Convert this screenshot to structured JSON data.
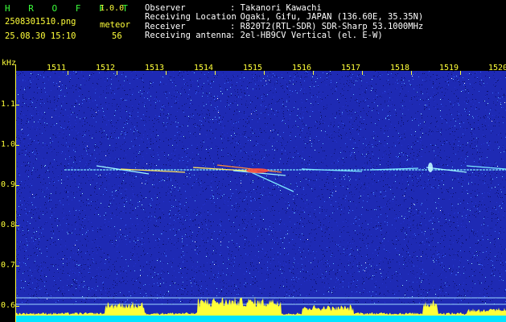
{
  "app": {
    "name": "H R O F F T",
    "version": "1.0.0"
  },
  "file": {
    "name": "2508301510.png",
    "datetime": "25.08.30 15:10"
  },
  "detection": {
    "label": "meteor",
    "count": "56"
  },
  "info": {
    "rows": [
      {
        "label": "Observer",
        "value": ": Takanori Kawachi"
      },
      {
        "label": "Receiving Location",
        "value": ": Ogaki, Gifu, JAPAN (136.60E, 35.35N)"
      },
      {
        "label": "Receiver",
        "value": ": R820T2(RTL-SDR) SDR-Sharp 53.1000MHz"
      },
      {
        "label": "Receiving antenna",
        "value": ": 2el-HB9CV Vertical (el. E-W)"
      }
    ]
  },
  "axes": {
    "y_unit": "kHz",
    "y_ticks": [
      "1.1",
      "1.0",
      "0.9",
      "0.8",
      "0.7",
      "0.6"
    ],
    "x_ticks": [
      "1511",
      "1512",
      "1513",
      "1514",
      "1515",
      "1516",
      "1517",
      "1518",
      "1519",
      "1520"
    ]
  },
  "colors": {
    "background": "#000000",
    "noise": "#1e2ab4",
    "axis": "#ffff3a",
    "title": "#3bff3b",
    "text": "#ffffff",
    "histogram": "#ffff3a",
    "baseline": "#00e5ff"
  }
}
